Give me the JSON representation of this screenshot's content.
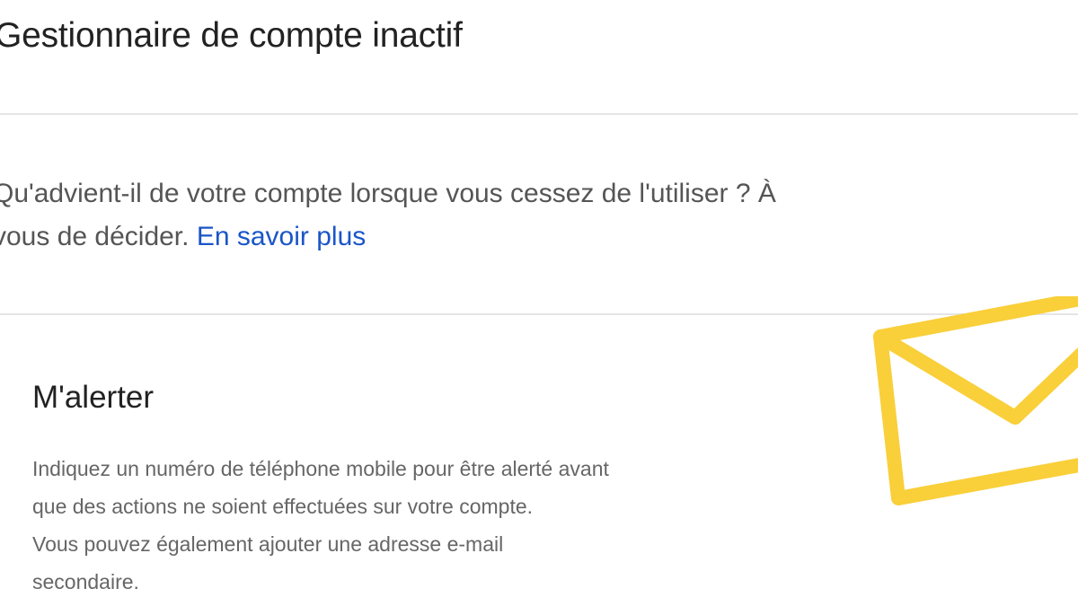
{
  "header": {
    "title": "Gestionnaire de compte inactif"
  },
  "intro": {
    "text": "Qu'advient-il de votre compte lorsque vous cessez de l'utiliser ? À vous de décider.",
    "link_label": "En savoir plus"
  },
  "alert_section": {
    "heading": "M'alerter",
    "body_lines": [
      "Indiquez un numéro de téléphone mobile pour être alerté avant",
      "que des actions ne soient effectuées sur votre compte.",
      "Vous pouvez également ajouter une adresse e-mail",
      "secondaire."
    ],
    "icon": "envelope-icon",
    "icon_color": "#f9cf3a"
  },
  "colors": {
    "link": "#1a55c8",
    "divider": "#e5e5e5",
    "body_text": "#666666"
  }
}
